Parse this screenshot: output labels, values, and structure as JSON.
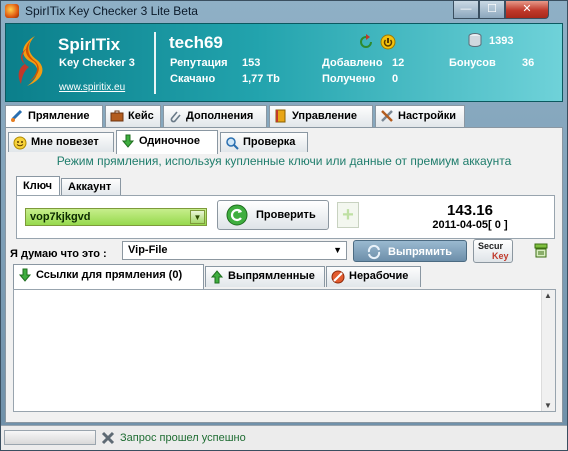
{
  "window": {
    "title": "SpirITix Key Checker 3 Lite Beta",
    "minimize": "—",
    "maximize": "☐",
    "close": "✕"
  },
  "header": {
    "brand": "SpirITix",
    "product": "Key Checker 3",
    "site": "www.spiritix.eu",
    "username": "tech69",
    "rep_label": "Репутация",
    "rep_value": "153",
    "downloaded_label": "Скачано",
    "downloaded_value": "1,77 Tb",
    "added_label": "Добавлено",
    "added_value": "12",
    "received_label": "Получено",
    "received_value": "0",
    "counter_value": "1393",
    "bonus_label": "Бонусов",
    "bonus_value": "36"
  },
  "main_tabs": [
    {
      "label": "Прямление"
    },
    {
      "label": "Кейс"
    },
    {
      "label": "Дополнения"
    },
    {
      "label": "Управление"
    },
    {
      "label": "Настройки"
    }
  ],
  "sub_tabs": [
    {
      "label": "Мне повезет"
    },
    {
      "label": "Одиночное"
    },
    {
      "label": "Проверка"
    }
  ],
  "mode_text": "Режим прямления, используя купленные ключи или данные от премиум аккаунта",
  "key_tabs": [
    {
      "label": "Ключ"
    },
    {
      "label": "Аккаунт"
    }
  ],
  "key": {
    "value": "vop7kjkgvd",
    "check_label": "Проверить",
    "add_label": "+",
    "score": "143.16",
    "date": "2011-04-05[ 0 ]"
  },
  "think": {
    "label": "Я думаю что это :",
    "value": "Vip-File",
    "fix_label": "Выпрямить",
    "secur_top": "Secur",
    "secur_bottom": "Key"
  },
  "list_tabs": [
    {
      "label": "Ссылки для прямления (0)"
    },
    {
      "label": "Выпрямленные"
    },
    {
      "label": "Нерабочие"
    }
  ],
  "status": {
    "progress": 0,
    "text": "Запрос прошел успешно"
  },
  "colors": {
    "header_teal": "#0b7f8b",
    "combo_green": "#96d94d",
    "status_green": "#1f6d33",
    "mode_text": "#1f7d6c"
  }
}
